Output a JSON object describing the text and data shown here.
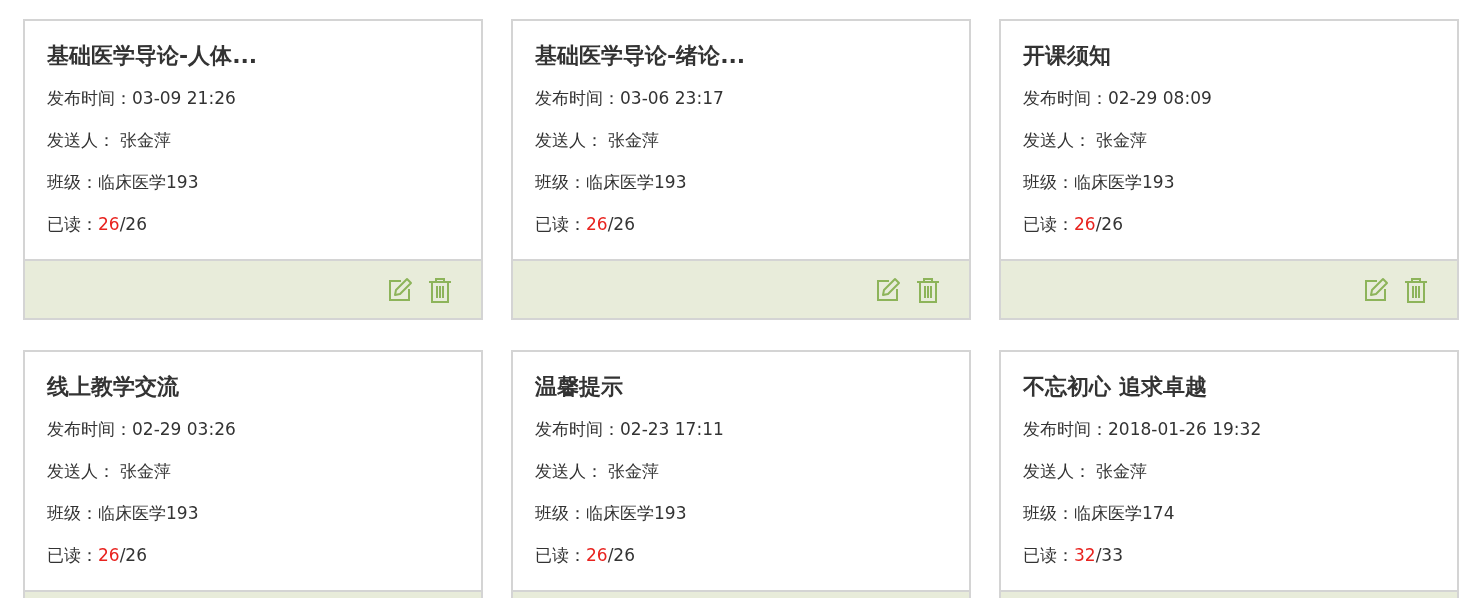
{
  "cards": [
    {
      "kind": "full",
      "title": "基础医学导论-人体...",
      "time": "发布时间：03-09 21:26",
      "sender": "发送人： 张金萍",
      "class": "班级：临床医学193",
      "read_label": "已读：",
      "read": "26",
      "total": "/26"
    },
    {
      "kind": "full",
      "title": "基础医学导论-绪论...",
      "time": "发布时间：03-06 23:17",
      "sender": "发送人： 张金萍",
      "class": "班级：临床医学193",
      "read_label": "已读：",
      "read": "26",
      "total": "/26"
    },
    {
      "kind": "full",
      "title": "开课须知",
      "time": "发布时间：02-29 08:09",
      "sender": "发送人： 张金萍",
      "class": "班级：临床医学193",
      "read_label": "已读：",
      "read": "26",
      "total": "/26"
    },
    {
      "kind": "cut",
      "title": "线上教学交流",
      "time": "发布时间：02-29 03:26",
      "sender": "发送人： 张金萍",
      "class": "班级：临床医学193",
      "read_label": "已读：",
      "read": "26",
      "total": "/26"
    },
    {
      "kind": "cut",
      "title": "温馨提示",
      "time": "发布时间：02-23 17:11",
      "sender": "发送人： 张金萍",
      "class": "班级：临床医学193",
      "read_label": "已读：",
      "read": "26",
      "total": "/26"
    },
    {
      "kind": "cut",
      "title": "不忘初心 追求卓越",
      "time": "发布时间：2018-01-26 19:32",
      "sender": "发送人： 张金萍",
      "class": "班级：临床医学174",
      "read_label": "已读：",
      "read": "32",
      "total": "/33"
    }
  ]
}
